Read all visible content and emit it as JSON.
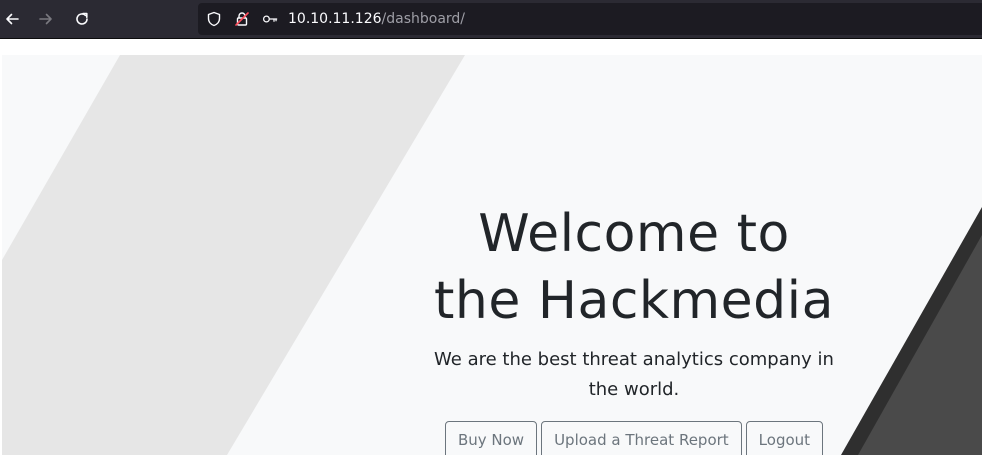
{
  "browser": {
    "url_host": "10.10.11.126",
    "url_path": "/dashboard/",
    "icons": {
      "back": "back-arrow-icon",
      "forward": "forward-arrow-icon",
      "reload": "reload-icon",
      "tracking": "shield-icon",
      "security": "insecure-lock-icon",
      "permissions": "key-icon"
    }
  },
  "hero": {
    "title_line1": "Welcome to",
    "title_line2": "the Hackmedia",
    "subtitle": "We are the best threat analytics company in the world.",
    "buttons": {
      "buy": "Buy Now",
      "upload": "Upload a Threat Report",
      "logout": "Logout"
    }
  },
  "colors": {
    "toolbar": "#2b2a33",
    "urlbar": "#1c1b22",
    "hero_bg": "#f8f9fa",
    "text": "#212529",
    "button_outline": "#6c757d",
    "deco_light": "#e6e6e6",
    "deco_dark": "#4a4a4a"
  }
}
